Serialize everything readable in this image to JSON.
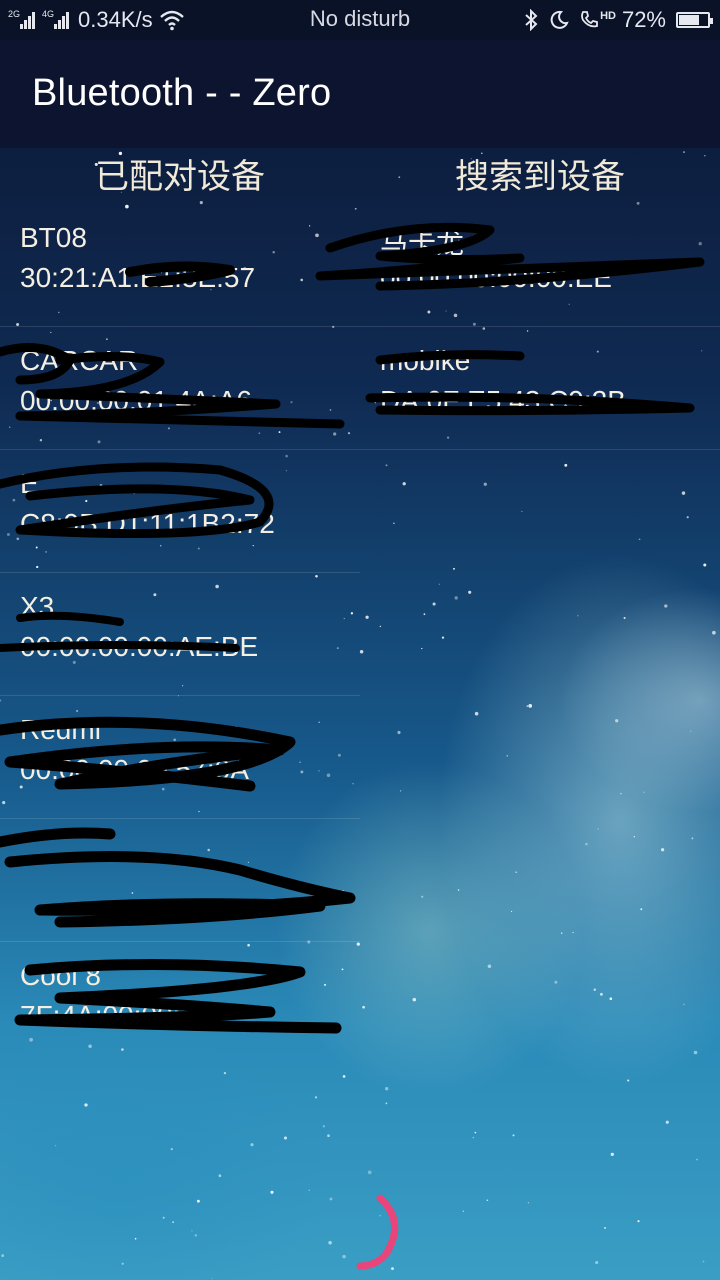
{
  "status_bar": {
    "sim1_label": "2G",
    "sim2_label": "4G",
    "net_speed": "0.34K/s",
    "mode_text": "No disturb",
    "icons": [
      "bluetooth-icon",
      "moon-icon",
      "phone-hd-icon"
    ],
    "hd_label": "HD",
    "battery_text": "72%",
    "battery_level": 0.72
  },
  "app_bar": {
    "title": "Bluetooth - - Zero"
  },
  "columns": {
    "paired_header": "已配对设备",
    "found_header": "搜索到设备"
  },
  "paired_devices": [
    {
      "name": "BT08",
      "address": "30:21:A1:E1:3E:57"
    },
    {
      "name": "CARCAR",
      "address": "00:00:00:01:4A:A6"
    },
    {
      "name": "E",
      "address": "C8:9B:D1:11:1B2:72"
    },
    {
      "name": "X3",
      "address": "00:00:00:00:AE:BE"
    },
    {
      "name": "Redmi",
      "address": "00:00:00:00:57:0A"
    },
    {
      "name": "",
      "address": ""
    },
    {
      "name": "Cool 8",
      "address": "7F:4A:00:00:3E"
    }
  ],
  "found_devices": [
    {
      "name": "马卡龙",
      "address": "00:00:00:00:00:EE"
    },
    {
      "name": "mobike",
      "address": "DA:0F:E5:43:C9:2B"
    }
  ],
  "colors": {
    "status_bar_bg": "#0a1228",
    "app_bar_bg": "#0c1430",
    "text": "#f4efe2",
    "spinner": "#e8457a"
  }
}
